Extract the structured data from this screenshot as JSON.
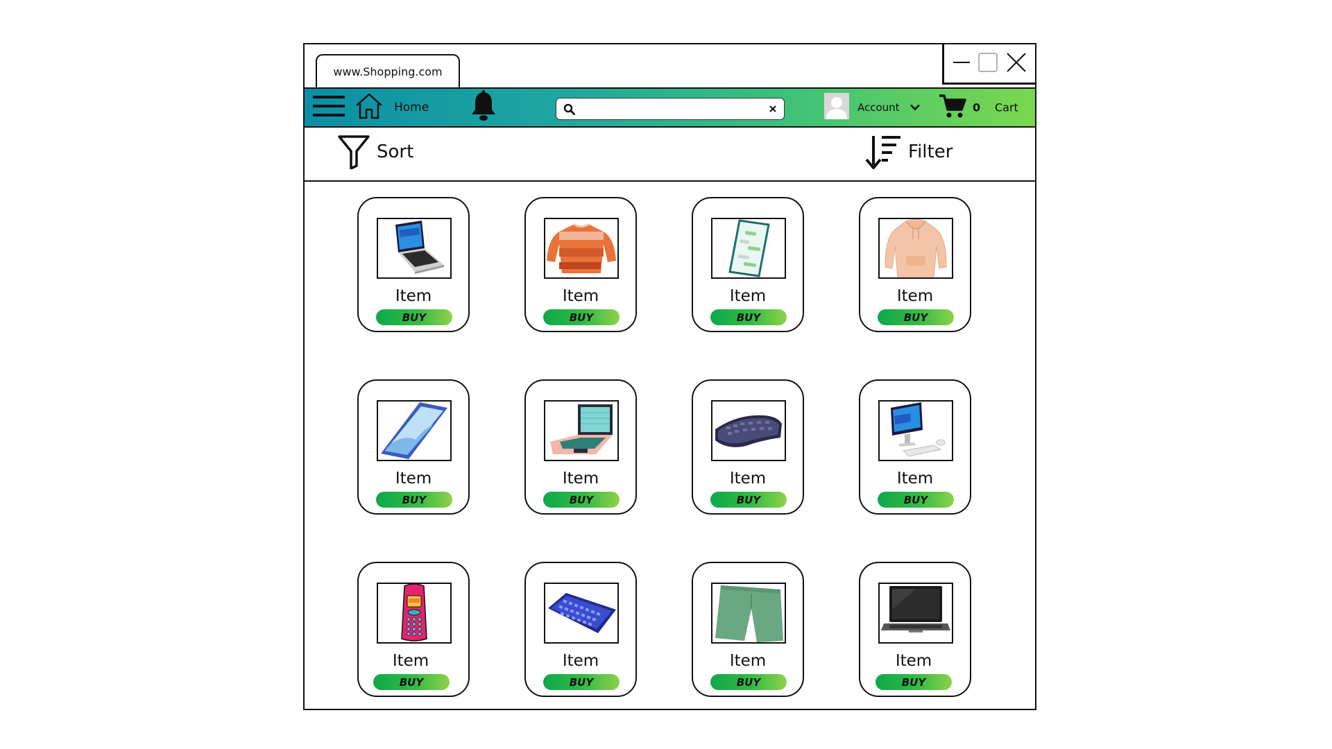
{
  "browser": {
    "tab_url": "www.Shopping.com"
  },
  "navbar": {
    "home_label": "Home",
    "search_value": "",
    "account_label": "Account",
    "cart_count": "0",
    "cart_label": "Cart"
  },
  "toolbar": {
    "sort_label": "Sort",
    "filter_label": "Filter"
  },
  "colors": {
    "navbar_gradient_start": "#0b8fa6",
    "navbar_gradient_end": "#7ad84e",
    "buy_gradient_start": "#0ea84a",
    "buy_gradient_end": "#8fd14a"
  },
  "products": [
    {
      "label": "Item",
      "buy_label": "BUY",
      "icon": "laptop-icon"
    },
    {
      "label": "Item",
      "buy_label": "BUY",
      "icon": "sweater-icon"
    },
    {
      "label": "Item",
      "buy_label": "BUY",
      "icon": "smartphone-chat-icon"
    },
    {
      "label": "Item",
      "buy_label": "BUY",
      "icon": "hoodie-icon"
    },
    {
      "label": "Item",
      "buy_label": "BUY",
      "icon": "tablet-icon"
    },
    {
      "label": "Item",
      "buy_label": "BUY",
      "icon": "pink-laptop-icon"
    },
    {
      "label": "Item",
      "buy_label": "BUY",
      "icon": "ergonomic-keyboard-icon"
    },
    {
      "label": "Item",
      "buy_label": "BUY",
      "icon": "desktop-computer-icon"
    },
    {
      "label": "Item",
      "buy_label": "BUY",
      "icon": "retro-phone-icon"
    },
    {
      "label": "Item",
      "buy_label": "BUY",
      "icon": "mechanical-keyboard-icon"
    },
    {
      "label": "Item",
      "buy_label": "BUY",
      "icon": "shorts-icon"
    },
    {
      "label": "Item",
      "buy_label": "BUY",
      "icon": "black-laptop-icon"
    }
  ]
}
